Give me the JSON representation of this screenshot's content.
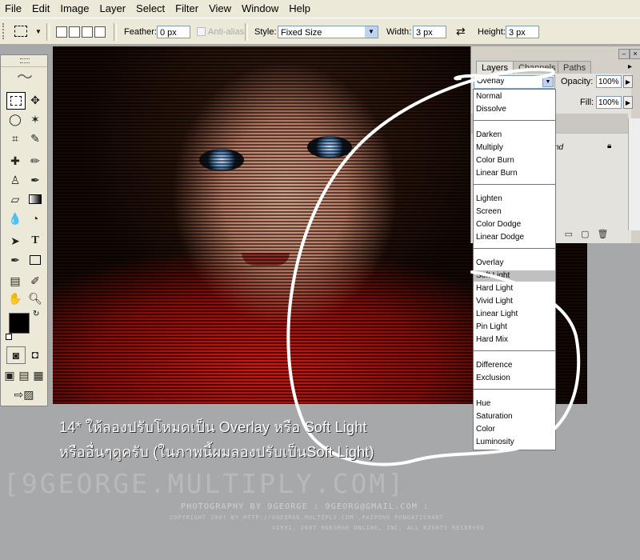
{
  "menubar": {
    "items": [
      "File",
      "Edit",
      "Image",
      "Layer",
      "Select",
      "Filter",
      "View",
      "Window",
      "Help"
    ]
  },
  "options": {
    "feather_label": "Feather:",
    "feather_value": "0 px",
    "antialias_label": "Anti-alias",
    "style_label": "Style:",
    "style_value": "Fixed Size",
    "width_label": "Width:",
    "width_value": "3 px",
    "height_label": "Height:",
    "height_value": "3 px"
  },
  "layers_panel": {
    "tabs": [
      "Layers",
      "Channels",
      "Paths"
    ],
    "active_tab": "Layers",
    "blend_mode": "Overlay",
    "opacity_label": "Opacity:",
    "opacity_value": "100%",
    "fill_label": "Fill:",
    "fill_value": "100%",
    "layer_text": "nd"
  },
  "blend_modes": {
    "groups": [
      [
        "Normal",
        "Dissolve"
      ],
      [
        "Darken",
        "Multiply",
        "Color Burn",
        "Linear Burn"
      ],
      [
        "Lighten",
        "Screen",
        "Color Dodge",
        "Linear Dodge"
      ],
      [
        "Overlay",
        "Soft Light",
        "Hard Light",
        "Vivid Light",
        "Linear Light",
        "Pin Light",
        "Hard Mix"
      ],
      [
        "Difference",
        "Exclusion"
      ],
      [
        "Hue",
        "Saturation",
        "Color",
        "Luminosity"
      ]
    ],
    "highlighted": "Soft Light"
  },
  "caption": {
    "line1": "14* ให้ลองปรับโหมดเป็น Overlay หรือ Soft Light",
    "line2": "หรืออื่นๆดูครับ (ในภาพนี้ผมลองปรับเป็นSoft Light)"
  },
  "watermark": {
    "main": "[9GEORGE.MULTIPLY.COM]",
    "line1": "PHOTOGRAPHY BY 9GEORGE : 9GEORG@GMAIL.COM :",
    "line2": "COPYRIGHT 2007 BY  HTTP://9GEORGE.MULTIPLY.COM  ,PAIPONG PONGATICHART",
    "line3": "©1991, 2007 9GEORGE ONLINE, INC. ALL RIGHTS RESERVED"
  },
  "colors": {
    "menubar": "#ece9d8",
    "workspace": "#a7a8aa",
    "highlight": "#c0c0c0"
  }
}
